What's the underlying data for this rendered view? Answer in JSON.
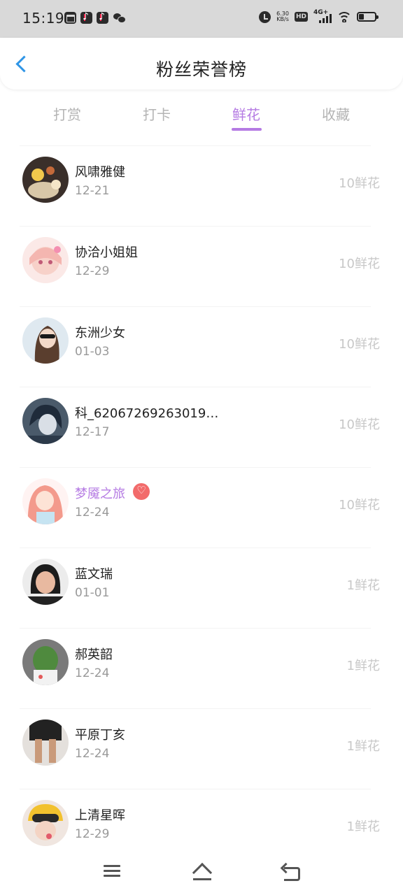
{
  "status_bar": {
    "time": "15:19",
    "net_speed_value": "6.30",
    "net_speed_unit": "KB/s",
    "hd": "HD",
    "network": "4G+",
    "notification_icons": [
      "mail-icon",
      "tiktok-icon",
      "tiktok-icon",
      "wechat-icon"
    ]
  },
  "header": {
    "title": "粉丝荣誉榜",
    "back_icon": "chevron-left-icon"
  },
  "tabs": [
    {
      "label": "打赏",
      "active": false
    },
    {
      "label": "打卡",
      "active": false
    },
    {
      "label": "鲜花",
      "active": true
    },
    {
      "label": "收藏",
      "active": false
    }
  ],
  "accent_color": "#b57be3",
  "fans": [
    {
      "name": "风啸雅健",
      "date": "12-21",
      "amount": "10鲜花",
      "vip": false
    },
    {
      "name": "协洽小姐姐",
      "date": "12-29",
      "amount": "10鲜花",
      "vip": false
    },
    {
      "name": "东洲少女",
      "date": "01-03",
      "amount": "10鲜花",
      "vip": false
    },
    {
      "name": "科_62067269263019…",
      "date": "12-17",
      "amount": "10鲜花",
      "vip": false
    },
    {
      "name": "梦魇之旅",
      "date": "12-24",
      "amount": "10鲜花",
      "vip": true
    },
    {
      "name": "蓝文瑞",
      "date": "01-01",
      "amount": "1鲜花",
      "vip": false
    },
    {
      "name": "郝英韶",
      "date": "12-24",
      "amount": "1鲜花",
      "vip": false
    },
    {
      "name": "平原丁亥",
      "date": "12-24",
      "amount": "1鲜花",
      "vip": false
    },
    {
      "name": "上清星晖",
      "date": "12-29",
      "amount": "1鲜花",
      "vip": false
    }
  ],
  "system_nav": [
    "menu-icon",
    "home-icon",
    "back-icon"
  ]
}
